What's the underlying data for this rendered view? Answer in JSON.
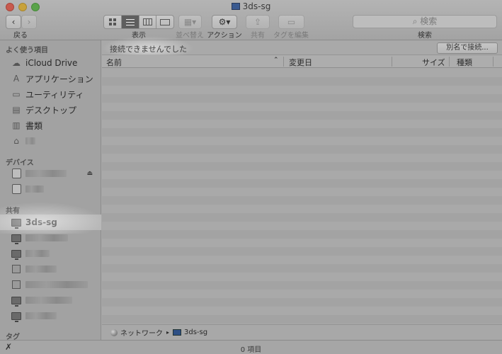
{
  "window": {
    "title": "3ds-sg"
  },
  "toolbar": {
    "back_label": "戻る",
    "view_label": "表示",
    "arrange_label": "並べ替え",
    "action_label": "アクション",
    "share_label": "共有",
    "tags_label": "タグを編集",
    "search_placeholder": "検索",
    "search_label": "検索"
  },
  "sidebar": {
    "favorites_header": "よく使う項目",
    "favorites": [
      {
        "label": "iCloud Drive",
        "icon": "cloud-icon"
      },
      {
        "label": "アプリケーション",
        "icon": "applications-icon"
      },
      {
        "label": "ユーティリティ",
        "icon": "folder-icon"
      },
      {
        "label": "デスクトップ",
        "icon": "desktop-icon"
      },
      {
        "label": "書類",
        "icon": "documents-icon"
      }
    ],
    "devices_header": "デバイス",
    "shared_header": "共有",
    "shared_selected": "3ds-sg",
    "tags_header": "タグ"
  },
  "main": {
    "error_message": "接続できませんでした",
    "connect_as_button": "別名で接続...",
    "columns": {
      "name": "名前",
      "modified": "変更日",
      "size": "サイズ",
      "kind": "種類"
    },
    "path": {
      "network": "ネットワーク",
      "server": "3ds-sg"
    }
  },
  "status": {
    "item_count": "0 項目"
  }
}
